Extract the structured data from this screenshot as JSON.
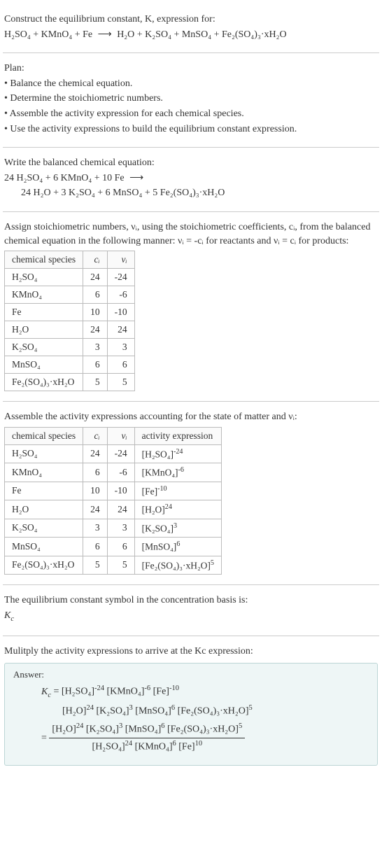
{
  "intro": {
    "line1": "Construct the equilibrium constant, K, expression for:",
    "eq_lhs": "H₂SO₄ + KMnO₄ + Fe",
    "eq_rhs": "H₂O + K₂SO₄ + MnSO₄ + Fe₂(SO₄)₃·xH₂O"
  },
  "plan": {
    "heading": "Plan:",
    "b1": "• Balance the chemical equation.",
    "b2": "• Determine the stoichiometric numbers.",
    "b3": "• Assemble the activity expression for each chemical species.",
    "b4": "• Use the activity expressions to build the equilibrium constant expression."
  },
  "balanced": {
    "heading": "Write the balanced chemical equation:",
    "lhs": "24 H₂SO₄ + 6 KMnO₄ + 10 Fe",
    "rhs": "24 H₂O + 3 K₂SO₄ + 6 MnSO₄ + 5 Fe₂(SO₄)₃·xH₂O"
  },
  "stoich": {
    "heading1": "Assign stoichiometric numbers, νᵢ, using the stoichiometric coefficients, cᵢ, from the balanced chemical equation in the following manner: νᵢ = -cᵢ for reactants and νᵢ = cᵢ for products:",
    "h_species": "chemical species",
    "h_ci": "cᵢ",
    "h_vi": "νᵢ",
    "rows": [
      {
        "sp": "H₂SO₄",
        "c": "24",
        "v": "-24"
      },
      {
        "sp": "KMnO₄",
        "c": "6",
        "v": "-6"
      },
      {
        "sp": "Fe",
        "c": "10",
        "v": "-10"
      },
      {
        "sp": "H₂O",
        "c": "24",
        "v": "24"
      },
      {
        "sp": "K₂SO₄",
        "c": "3",
        "v": "3"
      },
      {
        "sp": "MnSO₄",
        "c": "6",
        "v": "6"
      },
      {
        "sp": "Fe₂(SO₄)₃·xH₂O",
        "c": "5",
        "v": "5"
      }
    ]
  },
  "activity": {
    "heading": "Assemble the activity expressions accounting for the state of matter and νᵢ:",
    "h_species": "chemical species",
    "h_ci": "cᵢ",
    "h_vi": "νᵢ",
    "h_ae": "activity expression",
    "rows": [
      {
        "sp": "H₂SO₄",
        "c": "24",
        "v": "-24",
        "ae_base": "[H₂SO₄]",
        "ae_exp": "-24"
      },
      {
        "sp": "KMnO₄",
        "c": "6",
        "v": "-6",
        "ae_base": "[KMnO₄]",
        "ae_exp": "-6"
      },
      {
        "sp": "Fe",
        "c": "10",
        "v": "-10",
        "ae_base": "[Fe]",
        "ae_exp": "-10"
      },
      {
        "sp": "H₂O",
        "c": "24",
        "v": "24",
        "ae_base": "[H₂O]",
        "ae_exp": "24"
      },
      {
        "sp": "K₂SO₄",
        "c": "3",
        "v": "3",
        "ae_base": "[K₂SO₄]",
        "ae_exp": "3"
      },
      {
        "sp": "MnSO₄",
        "c": "6",
        "v": "6",
        "ae_base": "[MnSO₄]",
        "ae_exp": "6"
      },
      {
        "sp": "Fe₂(SO₄)₃·xH₂O",
        "c": "5",
        "v": "5",
        "ae_base": "[Fe₂(SO₄)₃·xH₂O]",
        "ae_exp": "5"
      }
    ]
  },
  "symbol": {
    "heading": "The equilibrium constant symbol in the concentration basis is:",
    "sym": "K",
    "sub": "c"
  },
  "final": {
    "heading": "Mulitply the activity expressions to arrive at the Kc expression:",
    "answer_label": "Answer:",
    "kc": "K",
    "kc_sub": "c",
    "line1_a": "= [H₂SO₄]",
    "line1_a_exp": "-24",
    "line1_b": " [KMnO₄]",
    "line1_b_exp": "-6",
    "line1_c": " [Fe]",
    "line1_c_exp": "-10",
    "line2_a": "[H₂O]",
    "line2_a_exp": "24",
    "line2_b": " [K₂SO₄]",
    "line2_b_exp": "3",
    "line2_c": " [MnSO₄]",
    "line2_c_exp": "6",
    "line2_d": " [Fe₂(SO₄)₃·xH₂O]",
    "line2_d_exp": "5",
    "num_a": "[H₂O]",
    "num_a_exp": "24",
    "num_b": " [K₂SO₄]",
    "num_b_exp": "3",
    "num_c": " [MnSO₄]",
    "num_c_exp": "6",
    "num_d": " [Fe₂(SO₄)₃·xH₂O]",
    "num_d_exp": "5",
    "den_a": "[H₂SO₄]",
    "den_a_exp": "24",
    "den_b": " [KMnO₄]",
    "den_b_exp": "6",
    "den_c": " [Fe]",
    "den_c_exp": "10"
  },
  "chart_data": {
    "type": "table",
    "tables": [
      {
        "title": "stoichiometric numbers",
        "columns": [
          "chemical species",
          "cᵢ",
          "νᵢ"
        ],
        "rows": [
          [
            "H₂SO₄",
            24,
            -24
          ],
          [
            "KMnO₄",
            6,
            -6
          ],
          [
            "Fe",
            10,
            -10
          ],
          [
            "H₂O",
            24,
            24
          ],
          [
            "K₂SO₄",
            3,
            3
          ],
          [
            "MnSO₄",
            6,
            6
          ],
          [
            "Fe₂(SO₄)₃·xH₂O",
            5,
            5
          ]
        ]
      },
      {
        "title": "activity expressions",
        "columns": [
          "chemical species",
          "cᵢ",
          "νᵢ",
          "activity expression"
        ],
        "rows": [
          [
            "H₂SO₄",
            24,
            -24,
            "[H₂SO₄]^-24"
          ],
          [
            "KMnO₄",
            6,
            -6,
            "[KMnO₄]^-6"
          ],
          [
            "Fe",
            10,
            -10,
            "[Fe]^-10"
          ],
          [
            "H₂O",
            24,
            24,
            "[H₂O]^24"
          ],
          [
            "K₂SO₄",
            3,
            3,
            "[K₂SO₄]^3"
          ],
          [
            "MnSO₄",
            6,
            6,
            "[MnSO₄]^6"
          ],
          [
            "Fe₂(SO₄)₃·xH₂O",
            5,
            5,
            "[Fe₂(SO₄)₃·xH₂O]^5"
          ]
        ]
      }
    ]
  }
}
